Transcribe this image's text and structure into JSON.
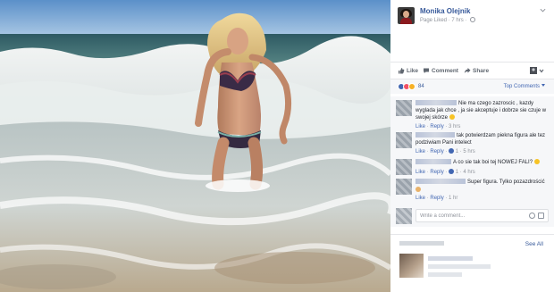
{
  "post": {
    "author": "Monika Olejnik",
    "meta": "Page Liked · 7 hrs ·"
  },
  "actions": {
    "like": "Like",
    "comment": "Comment",
    "share": "Share"
  },
  "reactions": {
    "count": "84",
    "sort_label": "Top Comments"
  },
  "comments": [
    {
      "text": "Nie ma czego zazroscic , kazdy wyglada jak chce , ja sie akceptuje i dobrze sie czuje w swojej skórze",
      "like": "Like",
      "reply": "Reply",
      "time": "3 hrs",
      "likes": ""
    },
    {
      "text": "tak potwierdzam piekna figura ale tez podziwiam Pani intelect",
      "like": "Like",
      "reply": "Reply",
      "time": "5 hrs",
      "likes": "1"
    },
    {
      "text": "A co sie tak boi tej NOWEJ FALI?",
      "like": "Like",
      "reply": "Reply",
      "time": "4 hrs",
      "likes": "1"
    },
    {
      "text": "Super figura. Tylko pozazdrościć",
      "like": "Like",
      "reply": "Reply",
      "time": "1 hr",
      "likes": ""
    }
  ],
  "composer": {
    "placeholder": "Write a comment..."
  },
  "sidebar": {
    "see_all": "See All"
  },
  "colors": {
    "link_blue": "#365899",
    "action_blue": "#4267b2",
    "muted_gray": "#90949c",
    "panel_bg": "#f6f7f9"
  },
  "icons": [
    "chevron-down-icon",
    "globe-icon",
    "like-icon",
    "comment-icon",
    "share-icon",
    "viewer-avatar-icon",
    "like-reaction-icon",
    "love-reaction-icon",
    "wow-reaction-icon",
    "smiley-icon",
    "camera-icon"
  ]
}
